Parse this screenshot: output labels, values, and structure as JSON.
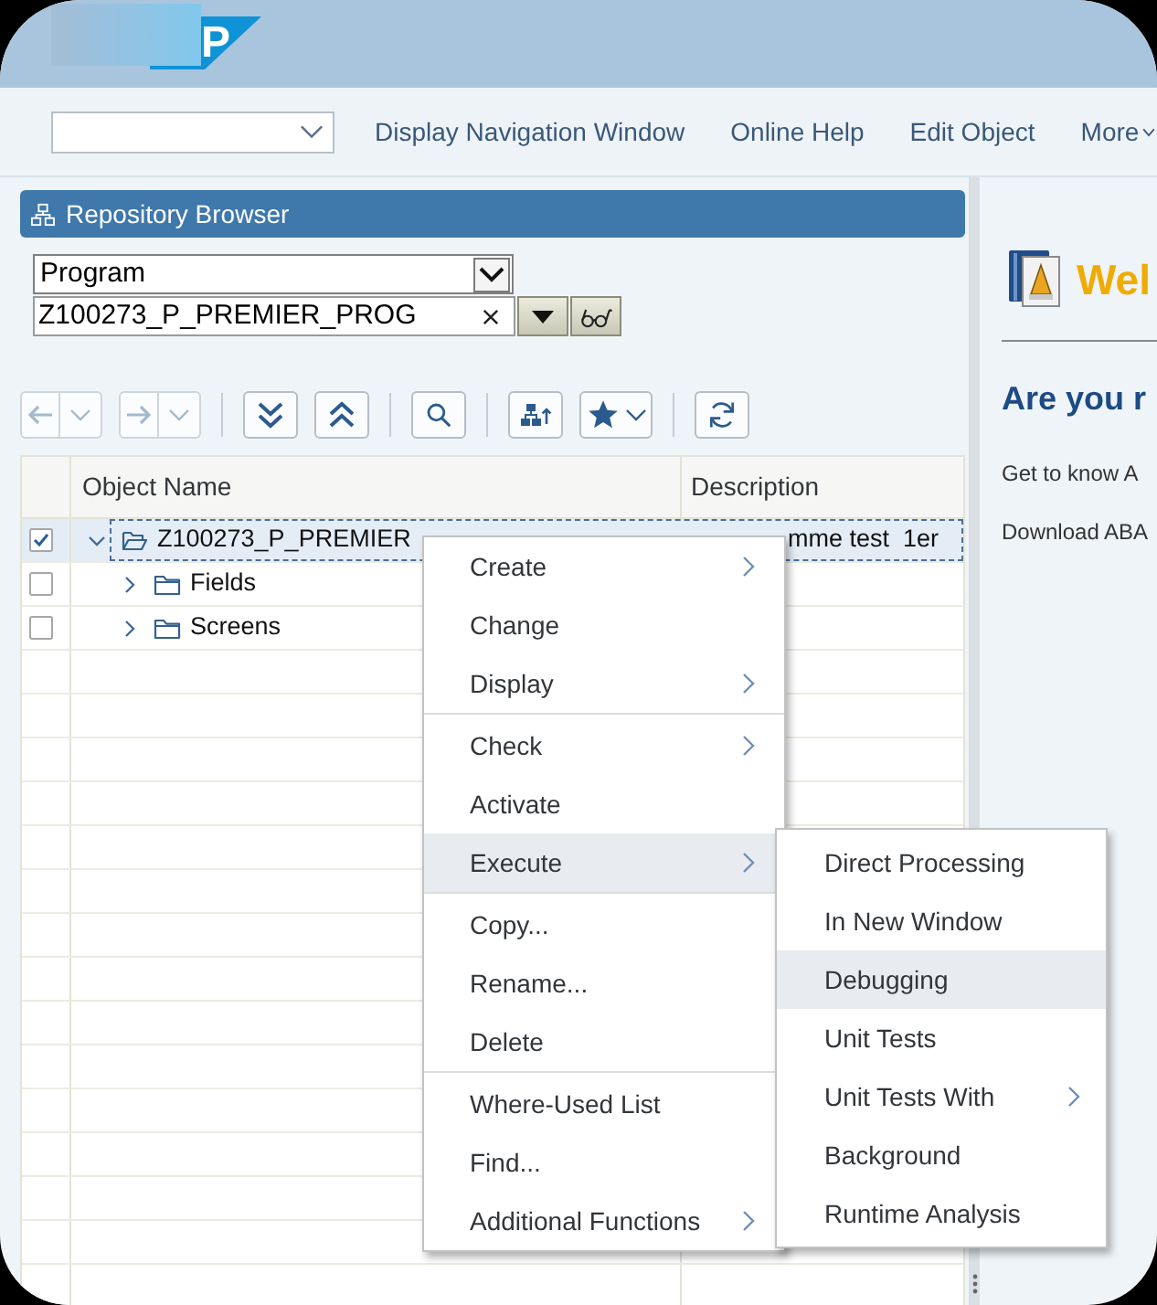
{
  "header": {
    "logo_text": "P"
  },
  "toolbar": {
    "links": [
      {
        "label": "Display Navigation Window",
        "has_menu": false
      },
      {
        "label": "Online Help",
        "has_menu": false
      },
      {
        "label": "Edit Object",
        "has_menu": false
      },
      {
        "label": "More",
        "has_menu": true
      }
    ]
  },
  "repository_browser": {
    "title": "Repository Browser",
    "object_type": "Program",
    "object_name": "Z100273_P_PREMIER_PROG",
    "tool_groups": [
      [
        {
          "kind": "back",
          "disabled": true,
          "has_menu": true
        },
        {
          "kind": "forward",
          "disabled": true,
          "has_menu": true
        }
      ],
      [
        {
          "kind": "expand_all",
          "disabled": false,
          "has_menu": false
        },
        {
          "kind": "collapse_all",
          "disabled": false,
          "has_menu": false
        }
      ],
      [
        {
          "kind": "search",
          "disabled": false,
          "has_menu": false
        }
      ],
      [
        {
          "kind": "hierarchy",
          "disabled": false,
          "has_menu": false
        },
        {
          "kind": "favorites",
          "disabled": false,
          "has_menu": true
        }
      ],
      [
        {
          "kind": "refresh",
          "disabled": false,
          "has_menu": false
        }
      ]
    ],
    "columns": [
      "Object Name",
      "Description"
    ],
    "tree": [
      {
        "kind": "program",
        "name": "Z100273_P_PREMIER",
        "description": "mme test  1er",
        "checked": true,
        "selected": true,
        "expanded": true,
        "children": [
          {
            "kind": "folder",
            "name": "Fields",
            "checked": false,
            "selected": false,
            "expanded": false
          },
          {
            "kind": "folder",
            "name": "Screens",
            "checked": false,
            "selected": false,
            "expanded": false
          }
        ]
      }
    ]
  },
  "context_menu": {
    "groups": [
      [
        {
          "label": "Create",
          "has_submenu": true,
          "selected": false
        },
        {
          "label": "Change",
          "has_submenu": false,
          "selected": false
        },
        {
          "label": "Display",
          "has_submenu": true,
          "selected": false
        }
      ],
      [
        {
          "label": "Check",
          "has_submenu": true,
          "selected": false
        },
        {
          "label": "Activate",
          "has_submenu": false,
          "selected": false
        },
        {
          "label": "Execute",
          "has_submenu": true,
          "selected": true
        }
      ],
      [
        {
          "label": "Copy...",
          "has_submenu": false,
          "selected": false
        },
        {
          "label": "Rename...",
          "has_submenu": false,
          "selected": false
        },
        {
          "label": "Delete",
          "has_submenu": false,
          "selected": false
        }
      ],
      [
        {
          "label": "Where-Used List",
          "has_submenu": false,
          "selected": false
        },
        {
          "label": "Find...",
          "has_submenu": false,
          "selected": false
        },
        {
          "label": "Additional Functions",
          "has_submenu": true,
          "selected": false
        }
      ]
    ]
  },
  "submenu": {
    "items": [
      {
        "label": "Direct Processing",
        "has_submenu": false,
        "selected": false
      },
      {
        "label": "In New Window",
        "has_submenu": false,
        "selected": false
      },
      {
        "label": "Debugging",
        "has_submenu": false,
        "selected": true
      },
      {
        "label": "Unit Tests",
        "has_submenu": false,
        "selected": false
      },
      {
        "label": "Unit Tests With",
        "has_submenu": true,
        "selected": false
      },
      {
        "label": "Background",
        "has_submenu": false,
        "selected": false
      },
      {
        "label": "Runtime Analysis",
        "has_submenu": false,
        "selected": false
      }
    ]
  },
  "welcome": {
    "title": "Wel",
    "heading": "Are you r",
    "links": [
      "Get to know A",
      "Download ABA"
    ]
  }
}
